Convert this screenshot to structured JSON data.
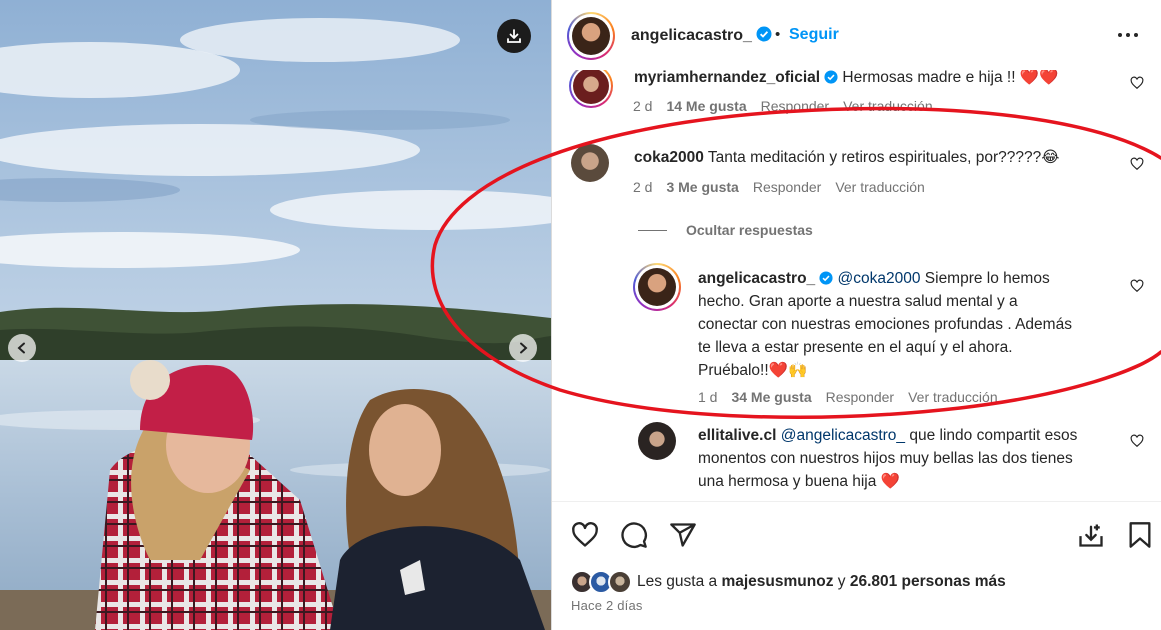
{
  "header": {
    "username": "angelicacastro_",
    "separator": "•",
    "follow_label": "Seguir",
    "icons": {
      "verified": "verified-badge-icon",
      "more": "more-options-icon"
    }
  },
  "photo": {
    "icons": {
      "download": "download-icon",
      "prev": "chevron-left-icon",
      "next": "chevron-right-icon"
    }
  },
  "comments": [
    {
      "username": "myriamhernandez_oficial",
      "verified": true,
      "text": "Hermosas madre e hija !! ❤️❤️",
      "time": "2 d",
      "likes": "14 Me gusta",
      "reply_label": "Responder",
      "translate_label": "Ver traducción"
    },
    {
      "username": "coka2000",
      "verified": false,
      "text": "Tanta meditación y retiros espirituales, por?????😂",
      "time": "2 d",
      "likes": "3 Me gusta",
      "reply_label": "Responder",
      "translate_label": "Ver traducción"
    }
  ],
  "hide_replies_label": "Ocultar respuestas",
  "reply": {
    "username": "angelicacastro_",
    "verified": true,
    "mention": "@coka2000",
    "text": "Siempre lo hemos hecho. Gran aporte a nuestra salud mental y a conectar con nuestras emociones profundas . Además te lleva a estar presente en el aquí y el ahora. Pruébalo!!❤️🙌",
    "line1_rest": "Siempre lo hemos",
    "line2": "hecho. Gran aporte a nuestra salud mental y a",
    "line3": "conectar con nuestras emociones profundas . Además",
    "line4": "te lleva a estar presente en el aquí y el ahora.",
    "line5": "Pruébalo!!❤️🙌",
    "time": "1 d",
    "likes": "34 Me gusta",
    "reply_label": "Responder",
    "translate_label": "Ver traducción"
  },
  "comment3": {
    "username": "ellitalive.cl",
    "mention": "@angelicacastro_",
    "line1_rest": "que lindo compartit esos",
    "line2": "monentos con nuestros hijos muy bellas las dos tienes",
    "line3": "una hermosa y buena hija ❤️"
  },
  "actions": {
    "icons": [
      "heart-icon",
      "comment-icon",
      "share-icon",
      "save-icon",
      "collection-icon"
    ]
  },
  "likes_line": {
    "prefix": "Les gusta a",
    "user": "majesusmunoz",
    "conjunction": "y",
    "others": "26.801 personas más"
  },
  "posted": "Hace 2 días",
  "colors": {
    "link": "#0095f6",
    "mention": "#00376b",
    "meta": "#737373",
    "annotation": "#e5141e"
  }
}
